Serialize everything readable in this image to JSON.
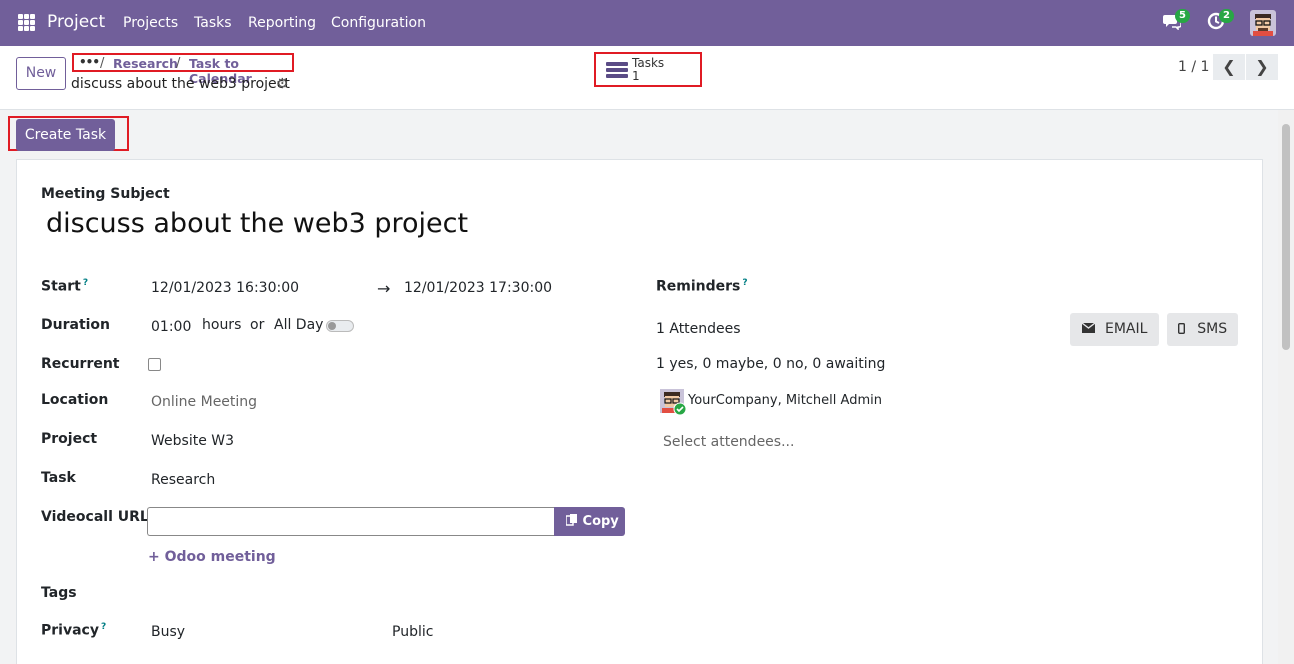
{
  "navbar": {
    "app_name": "Project",
    "menu": [
      "Projects",
      "Tasks",
      "Reporting",
      "Configuration"
    ],
    "messages_count": "5",
    "activities_count": "2"
  },
  "control_panel": {
    "new_label": "New",
    "breadcrumb": {
      "ellipsis": "•••",
      "items": [
        "Research",
        "Task to Calendar"
      ],
      "separator": "/"
    },
    "record_title": "discuss about the web3 project",
    "smart_button": {
      "label": "Tasks",
      "count": "1"
    },
    "pager": {
      "value": "1 / 1"
    }
  },
  "actions": {
    "create_task_label": "Create Task"
  },
  "form": {
    "subject_label": "Meeting Subject",
    "subject_value": "discuss about the web3 project",
    "start": {
      "label": "Start",
      "help": "?",
      "from": "12/01/2023 16:30:00",
      "arrow": "→",
      "to": "12/01/2023 17:30:00"
    },
    "duration": {
      "label": "Duration",
      "value": "01:00",
      "unit": "hours",
      "or": "or",
      "all_day_label": "All Day",
      "all_day": false
    },
    "recurrent": {
      "label": "Recurrent",
      "checked": false
    },
    "location": {
      "label": "Location",
      "placeholder": "Online Meeting"
    },
    "project": {
      "label": "Project",
      "value": "Website W3"
    },
    "task": {
      "label": "Task",
      "value": "Research"
    },
    "videocall": {
      "label": "Videocall URL",
      "value": "",
      "copy_label": "Copy",
      "odoo_meeting_label": "Odoo meeting"
    },
    "tags": {
      "label": "Tags"
    },
    "privacy": {
      "label": "Privacy",
      "help": "?",
      "show_as": "Busy",
      "privacy": "Public"
    },
    "reminders": {
      "label": "Reminders",
      "help": "?"
    },
    "attendees": {
      "count_label": "1 Attendees",
      "summary": "1 yes, 0 maybe, 0 no, 0 awaiting",
      "list": [
        "YourCompany, Mitchell Admin"
      ],
      "select_placeholder": "Select attendees...",
      "email_label": "EMAIL",
      "sms_label": "SMS"
    }
  },
  "colors": {
    "brand": "#715f9a",
    "highlight": "#e01b24",
    "badge": "#28a745"
  }
}
